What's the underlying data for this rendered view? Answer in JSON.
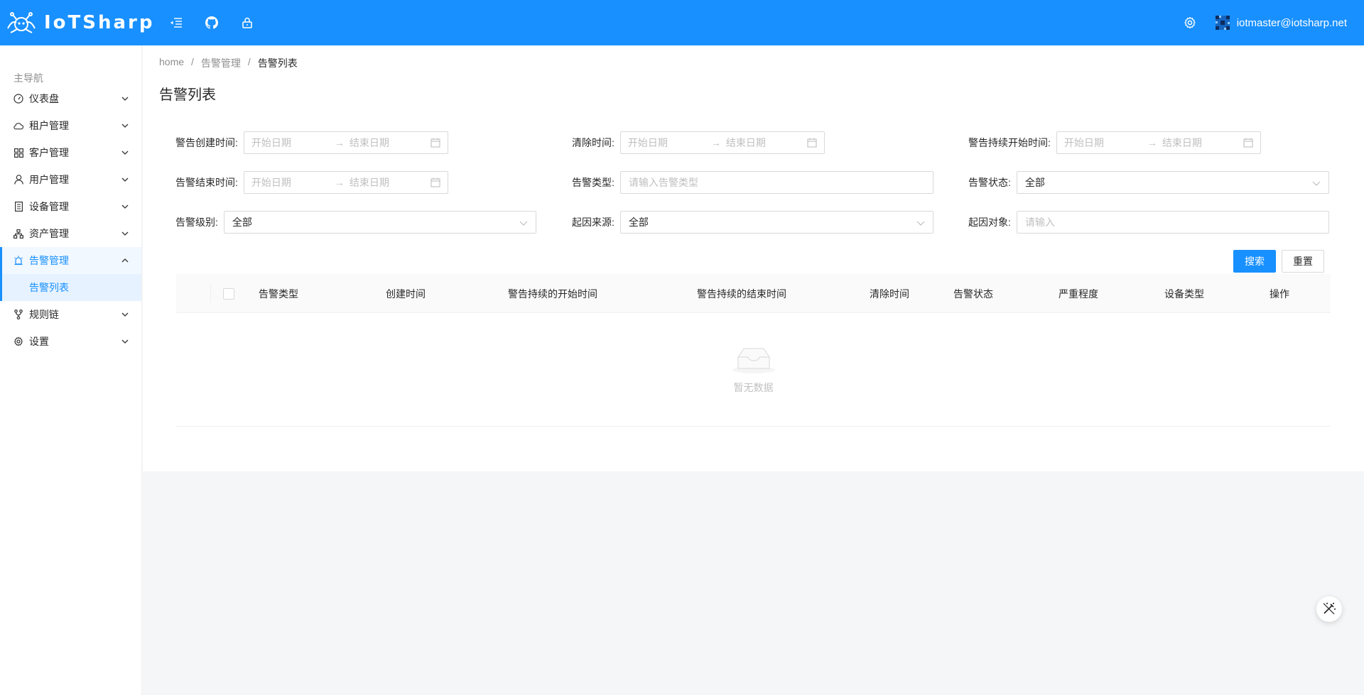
{
  "header": {
    "brand": "IoTSharp",
    "user_email": "iotmaster@iotsharp.net",
    "accent": "#1890ff"
  },
  "sidebar": {
    "group_label": "主导航",
    "items": [
      {
        "label": "仪表盘",
        "icon": "dashboard-icon"
      },
      {
        "label": "租户管理",
        "icon": "cloud-icon"
      },
      {
        "label": "客户管理",
        "icon": "appstore-icon"
      },
      {
        "label": "用户管理",
        "icon": "user-icon"
      },
      {
        "label": "设备管理",
        "icon": "device-icon"
      },
      {
        "label": "资产管理",
        "icon": "cluster-icon"
      },
      {
        "label": "告警管理",
        "icon": "alert-icon",
        "open": true
      },
      {
        "label": "规则链",
        "icon": "branch-icon"
      },
      {
        "label": "设置",
        "icon": "setting-icon"
      }
    ],
    "submenu": {
      "label": "告警列表"
    }
  },
  "breadcrumb": [
    "home",
    "告警管理",
    "告警列表"
  ],
  "page_title": "告警列表",
  "filters": {
    "created_time": {
      "label": "警告创建时间:",
      "start": "开始日期",
      "end": "结束日期"
    },
    "cleared_time": {
      "label": "清除时间:",
      "start": "开始日期",
      "end": "结束日期"
    },
    "start_time": {
      "label": "警告持续开始时间:",
      "start": "开始日期",
      "end": "结束日期"
    },
    "end_time": {
      "label": "告警结束时间:",
      "start": "开始日期",
      "end": "结束日期"
    },
    "alarm_type": {
      "label": "告警类型:",
      "placeholder": "请输入告警类型"
    },
    "alarm_status": {
      "label": "告警状态:",
      "value": "全部"
    },
    "severity": {
      "label": "告警级别:",
      "value": "全部"
    },
    "originator_type": {
      "label": "起因来源:",
      "value": "全部"
    },
    "originator": {
      "label": "起因对象:",
      "placeholder": "请输入"
    }
  },
  "buttons": {
    "search": "搜索",
    "reset": "重置"
  },
  "table": {
    "columns": [
      "告警类型",
      "创建时间",
      "警告持续的开始时间",
      "警告持续的结束时间",
      "清除时间",
      "告警状态",
      "严重程度",
      "设备类型",
      "操作"
    ],
    "empty_text": "暂无数据"
  }
}
